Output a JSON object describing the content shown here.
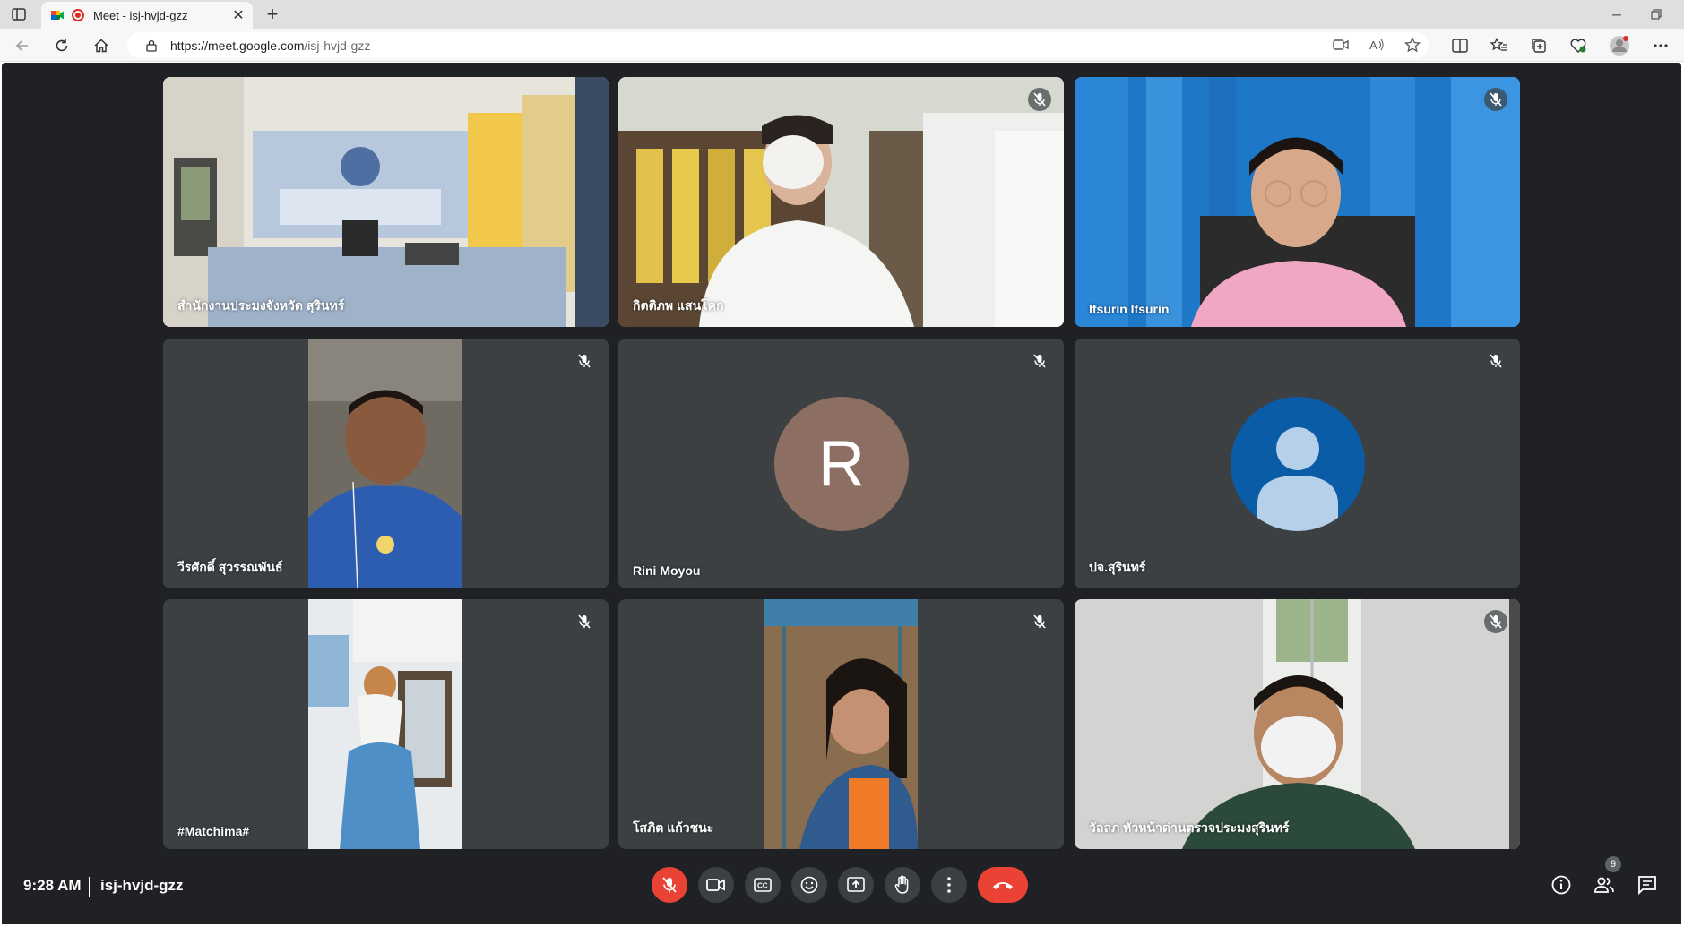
{
  "browser": {
    "tab_title": "Meet - isj-hvjd-gzz",
    "url_host": "https://meet.google.com",
    "url_path": "/isj-hvjd-gzz"
  },
  "participants": [
    {
      "name": "สำนักงานประมงจังหวัด สุรินทร์",
      "muted": false,
      "display": "video",
      "scene": "office-room"
    },
    {
      "name": "กิตติภพ แสนโคก",
      "muted": true,
      "display": "video",
      "scene": "man-mask-shelves"
    },
    {
      "name": "Ifsurin Ifsurin",
      "muted": true,
      "display": "video",
      "scene": "woman-blue-curtain"
    },
    {
      "name": "วีรศักดิ์ สุวรรณพันธ์",
      "muted": true,
      "display": "video-portrait",
      "scene": "man-blue-shirt"
    },
    {
      "name": "Rini Moyou",
      "muted": true,
      "display": "avatar-letter",
      "avatar_letter": "R",
      "avatar_color": "#8d6e63"
    },
    {
      "name": "ปจ.สุรินทร์",
      "muted": true,
      "display": "avatar-default",
      "avatar_color": "#0b5ca6"
    },
    {
      "name": "#Matchima#",
      "muted": true,
      "display": "video-portrait",
      "scene": "woman-walking"
    },
    {
      "name": "โสภิต แก้วชนะ",
      "muted": true,
      "display": "video-portrait",
      "scene": "woman-orange"
    },
    {
      "name": "วัลลภ หัวหน้าด่านตรวจประมงสุรินทร์",
      "muted": true,
      "display": "video",
      "scene": "man-mask-window"
    }
  ],
  "meeting": {
    "time": "9:28 AM",
    "code": "isj-hvjd-gzz",
    "participant_count": "9"
  },
  "controls": [
    "mic-off-icon",
    "camera-icon",
    "captions-icon",
    "emoji-icon",
    "present-icon",
    "raise-hand-icon",
    "more-options-icon",
    "end-call-icon"
  ],
  "colors": {
    "meet_bg": "#202124",
    "tile_bg": "#3c4043",
    "danger": "#ea4335"
  }
}
